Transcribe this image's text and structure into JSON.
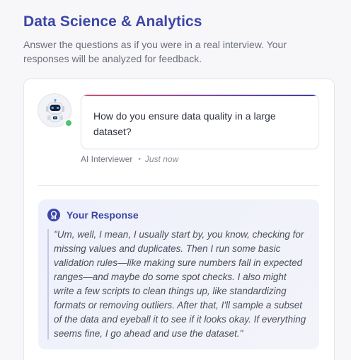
{
  "header": {
    "title": "Data Science & Analytics",
    "subtitle": "Answer the questions as if you were in a real interview. Your responses will be analyzed for feedback."
  },
  "interviewer": {
    "avatar_icon": "robot-icon",
    "status_color": "#4cc36f",
    "question": "How do you ensure data quality in a large dataset?",
    "name": "AI Interviewer",
    "separator": "•",
    "timestamp": "Just now"
  },
  "response": {
    "icon": "award-badge-icon",
    "title": "Your Response",
    "text": "\"Um, well, I mean, I usually start by, you know, checking for missing values and duplicates. Then I run some basic validation rules—like making sure numbers fall in expected ranges—and maybe do some spot checks. I also might write a few scripts to clean things up, like standardizing formats or removing outliers. After that, I'll sample a subset of the data and eyeball it to see if it looks okay. If everything seems fine, I go ahead and use the dataset.\""
  },
  "colors": {
    "accent": "#3c46a6",
    "gradient_start": "#d9506e",
    "gradient_end": "#3b3fa8"
  }
}
